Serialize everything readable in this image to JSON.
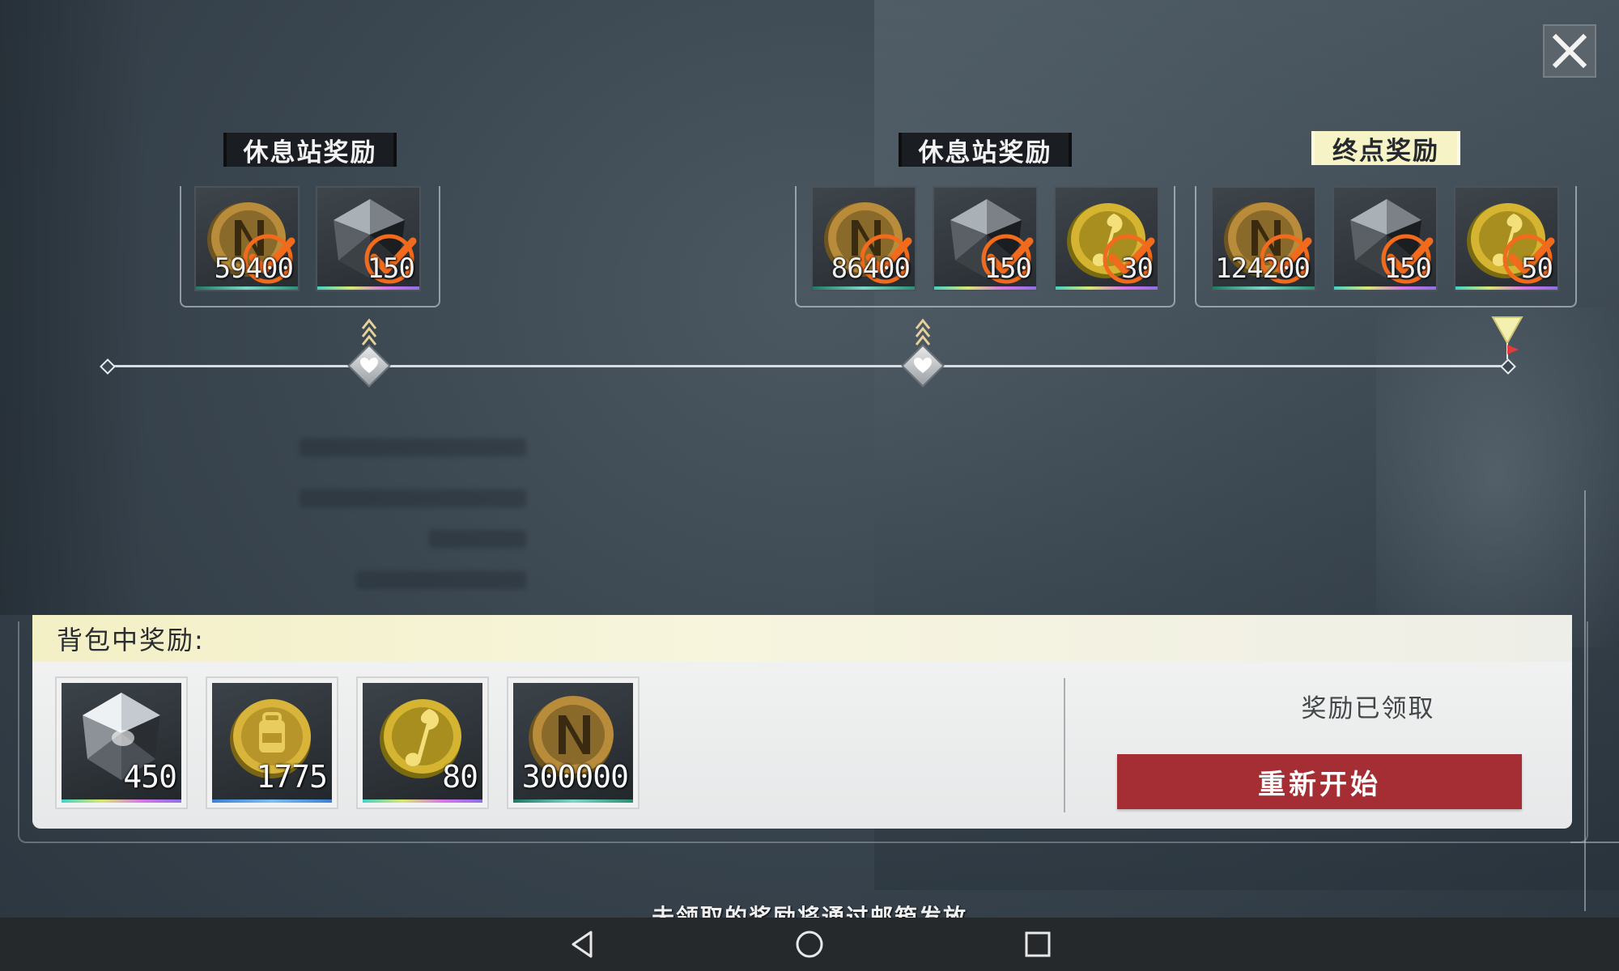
{
  "stages": [
    {
      "title": "休息站奖励",
      "style": "dark",
      "rewards": [
        {
          "icon": "n-gold-coin-icon",
          "qty": "59400",
          "claimed": true,
          "quality": "green"
        },
        {
          "icon": "dark-crystal-icon",
          "qty": "150",
          "claimed": true,
          "quality": "rainbow"
        }
      ]
    },
    {
      "title": "休息站奖励",
      "style": "dark",
      "rewards": [
        {
          "icon": "n-gold-coin-icon",
          "qty": "86400",
          "claimed": true,
          "quality": "green"
        },
        {
          "icon": "dark-crystal-icon",
          "qty": "150",
          "claimed": true,
          "quality": "rainbow"
        },
        {
          "icon": "music-note-coin-icon",
          "qty": "30",
          "claimed": true,
          "quality": "rainbow"
        }
      ]
    },
    {
      "title": "终点奖励",
      "style": "light",
      "rewards": [
        {
          "icon": "n-gold-coin-icon",
          "qty": "124200",
          "claimed": true,
          "quality": "green"
        },
        {
          "icon": "dark-crystal-icon",
          "qty": "150",
          "claimed": true,
          "quality": "rainbow"
        },
        {
          "icon": "music-note-coin-icon",
          "qty": "50",
          "claimed": true,
          "quality": "rainbow"
        }
      ]
    }
  ],
  "timeline": {
    "nodes": [
      "start",
      "rest-stop",
      "rest-stop",
      "finish"
    ]
  },
  "backpack": {
    "title": "背包中奖励:",
    "items": [
      {
        "icon": "crystal-icon",
        "qty": "450",
        "quality": "rainbow"
      },
      {
        "icon": "backpack-gold-coin-icon",
        "qty": "1775",
        "quality": "blue"
      },
      {
        "icon": "music-note-coin-icon",
        "qty": "80",
        "quality": "rainbow"
      },
      {
        "icon": "n-gold-coin-icon",
        "qty": "300000",
        "quality": "green"
      }
    ],
    "claimed_text": "奖励已领取",
    "restart_label": "重新开始"
  },
  "footer_note": "未领取的奖励将通过邮箱发放",
  "colors": {
    "restart_button": "#a42e33",
    "claim_check": "#f26b1d",
    "light_title_bg": "#f6f3c6",
    "dark_title_bg": "#1a1e22"
  },
  "navbar": [
    "back-icon",
    "home-icon",
    "recents-icon"
  ]
}
